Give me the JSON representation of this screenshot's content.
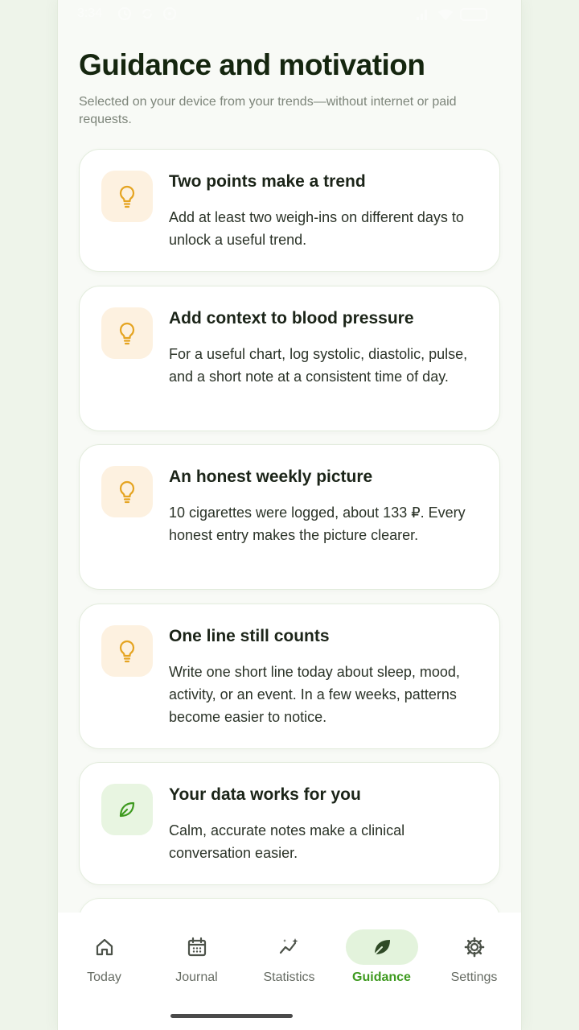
{
  "status_bar": {
    "time": "3:34",
    "icons": [
      "clock-icon",
      "sync-icon",
      "vpn-icon",
      "signal-icon",
      "wifi-icon",
      "battery-icon"
    ]
  },
  "page": {
    "title": "Guidance and motivation",
    "subtitle": "Selected on your device from your trends—without internet or paid requests."
  },
  "cards": [
    {
      "icon": "lightbulb-icon",
      "title": "Two points make a trend",
      "body": "Add at least two weigh-ins on different days to unlock a useful trend."
    },
    {
      "icon": "lightbulb-icon",
      "title": "Add context to blood pressure",
      "body": "For a useful chart, log systolic, diastolic, pulse, and a short note at a consistent time of day."
    },
    {
      "icon": "lightbulb-icon",
      "title": "An honest weekly picture",
      "body": "10 cigarettes were logged, about 133 ₽. Every honest entry makes the picture clearer."
    },
    {
      "icon": "lightbulb-icon",
      "title": "One line still counts",
      "body": "Write one short line today about sleep, mood, activity, or an event. In a few weeks, patterns become easier to notice."
    },
    {
      "icon": "leaf-icon",
      "title": "Your data works for you",
      "body": "Calm, accurate notes make a clinical conversation easier."
    }
  ],
  "nav": {
    "items": [
      {
        "label": "Today",
        "icon": "home-icon"
      },
      {
        "label": "Journal",
        "icon": "calendar-icon"
      },
      {
        "label": "Statistics",
        "icon": "trend-sparkle-icon"
      },
      {
        "label": "Guidance",
        "icon": "leaf-icon"
      },
      {
        "label": "Settings",
        "icon": "gear-icon"
      }
    ],
    "active": "Guidance"
  },
  "colors": {
    "accent": "#3e9a1f",
    "tip_icon": "#e5a421",
    "tip_icon_bg": "#fdf1e0",
    "leaf_icon_bg": "#e8f5e1"
  }
}
